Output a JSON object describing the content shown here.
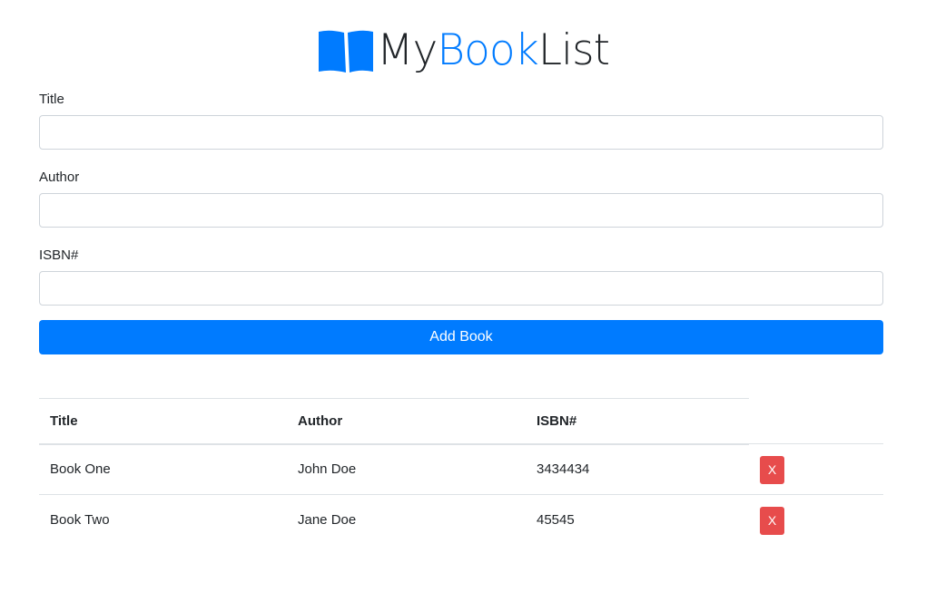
{
  "header": {
    "logo_icon": "open-book-icon",
    "logo_text_1": "My",
    "logo_text_2": "Book",
    "logo_text_3": "List",
    "accent_color": "#007bff"
  },
  "form": {
    "title_label": "Title",
    "title_value": "",
    "author_label": "Author",
    "author_value": "",
    "isbn_label": "ISBN#",
    "isbn_value": "",
    "submit_label": "Add Book",
    "submit_color": "#007bff"
  },
  "table": {
    "headers": [
      "Title",
      "Author",
      "ISBN#",
      ""
    ],
    "rows": [
      {
        "title": "Book One",
        "author": "John Doe",
        "isbn": "3434434",
        "delete_label": "X"
      },
      {
        "title": "Book Two",
        "author": "Jane Doe",
        "isbn": "45545",
        "delete_label": "X"
      }
    ],
    "delete_color": "#e74c4c"
  }
}
